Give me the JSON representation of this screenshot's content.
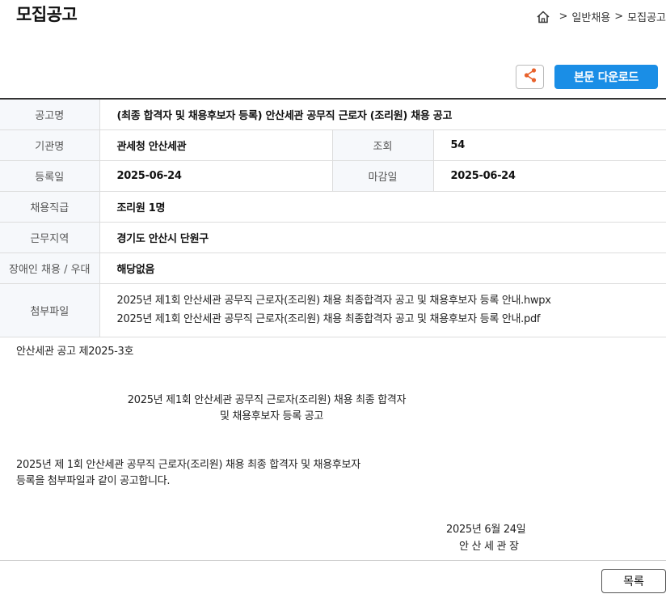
{
  "page": {
    "title": "모집공고"
  },
  "breadcrumb": {
    "sep1": ">",
    "item1": "일반채용",
    "sep2": ">",
    "item2": "모집공고"
  },
  "toolbar": {
    "download_label": "본문 다운로드"
  },
  "info": {
    "notice_name_label": "공고명",
    "notice_name": "(최종 합격자 및 채용후보자 등록) 안산세관 공무직 근로자 (조리원) 채용 공고",
    "agency_label": "기관명",
    "agency": "관세청 안산세관",
    "views_label": "조회",
    "views": "54",
    "reg_date_label": "등록일",
    "reg_date": "2025-06-24",
    "deadline_label": "마감일",
    "deadline": "2025-06-24",
    "position_label": "채용직급",
    "position": "조리원 1명",
    "location_label": "근무지역",
    "location": "경기도 안산시 단원구",
    "disability_label": "장애인 채용 / 우대",
    "disability": "해당없음",
    "files_label": "첨부파일",
    "files": [
      "2025년 제1회 안산세관 공무직 근로자(조리원) 채용 최종합격자 공고 및 채용후보자 등록 안내.hwpx",
      "2025년 제1회 안산세관 공무직 근로자(조리원) 채용 최종합격자 공고 및 채용후보자 등록 안내.pdf"
    ]
  },
  "content": {
    "notice_no": "안산세관 공고 제2025-3호",
    "heading_line1": "2025년 제1회 안산세관 공무직 근로자(조리원) 채용 최종 합격자",
    "heading_line2": "및 채용후보자 등록 공고",
    "para_line1": "2025년 제 1회 안산세관 공무직 근로자(조리원) 채용 최종 합격자 및 채용후보자",
    "para_line2": "등록을 첨부파일과 같이 공고합니다.",
    "date": "2025년 6월 24일",
    "signer": "안 산 세 관 장"
  },
  "footer": {
    "list_label": "목록"
  },
  "colors": {
    "accent": "#1a8ee6",
    "share_icon": "#e8622c"
  }
}
